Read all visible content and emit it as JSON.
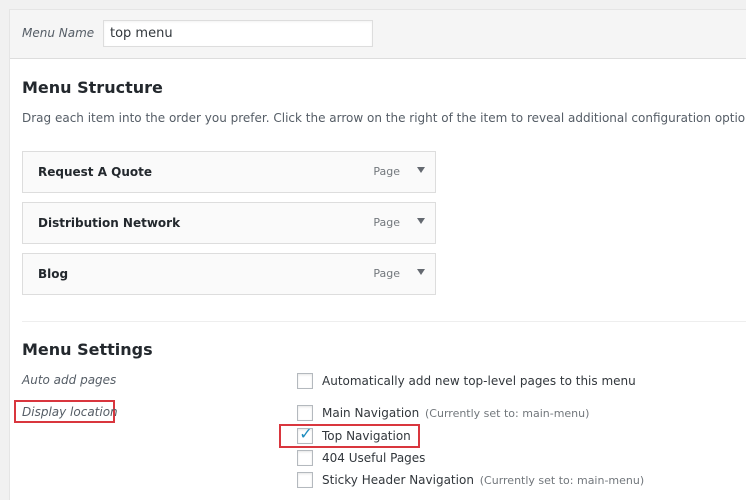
{
  "menu_name": {
    "label": "Menu Name",
    "value": "top menu"
  },
  "menu_structure": {
    "title": "Menu Structure",
    "instructions": "Drag each item into the order you prefer. Click the arrow on the right of the item to reveal additional configuration options.",
    "items": [
      {
        "title": "Request A Quote",
        "type": "Page"
      },
      {
        "title": "Distribution Network",
        "type": "Page"
      },
      {
        "title": "Blog",
        "type": "Page"
      }
    ]
  },
  "menu_settings": {
    "title": "Menu Settings",
    "auto_add": {
      "label": "Auto add pages",
      "option": "Automatically add new top-level pages to this menu",
      "checked": false
    },
    "display_location": {
      "label": "Display location",
      "options": [
        {
          "label": "Main Navigation",
          "note": "(Currently set to: main-menu)",
          "checked": false
        },
        {
          "label": "Top Navigation",
          "note": "",
          "checked": true
        },
        {
          "label": "404 Useful Pages",
          "note": "",
          "checked": false
        },
        {
          "label": "Sticky Header Navigation",
          "note": "(Currently set to: main-menu)",
          "checked": false
        }
      ]
    }
  },
  "colors": {
    "highlight": "#d9363e",
    "check": "#1e8cbe"
  }
}
